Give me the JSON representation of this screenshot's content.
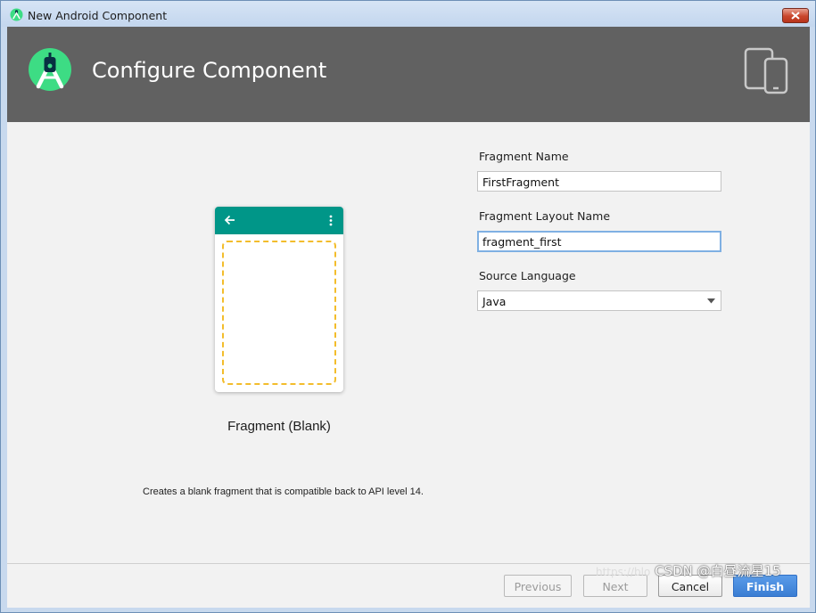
{
  "window": {
    "title": "New Android Component",
    "close_icon": "close-x-icon"
  },
  "header": {
    "title": "Configure Component",
    "logo_icon": "android-studio-logo",
    "device_icon": "phone-tablet-icon"
  },
  "preview": {
    "template_name": "Fragment (Blank)",
    "description": "Creates a blank fragment that is compatible back to API level 14.",
    "appbar_color": "#009688",
    "placeholder_border_color": "#f3bd2c"
  },
  "form": {
    "fragment_name": {
      "label": "Fragment Name",
      "value": "FirstFragment"
    },
    "layout_name": {
      "label": "Fragment Layout Name",
      "value": "fragment_first"
    },
    "source_language": {
      "label": "Source Language",
      "value": "Java"
    }
  },
  "buttons": {
    "previous": "Previous",
    "next": "Next",
    "cancel": "Cancel",
    "finish": "Finish"
  },
  "watermark": {
    "url": "https://blo",
    "text": "CSDN @白昼流星15"
  },
  "colors": {
    "header_bg": "#616161",
    "primary_button": "#3a7dd3",
    "focus_border": "#7fb0e3"
  }
}
